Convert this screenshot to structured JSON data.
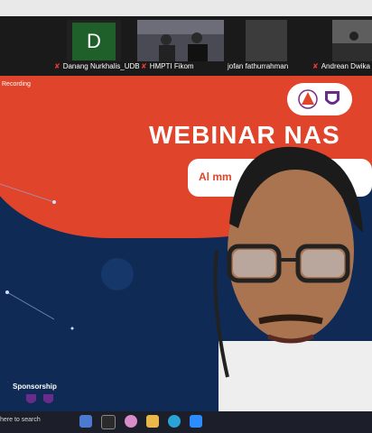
{
  "participants": [
    {
      "name": "Danang Nurkhalis_UDB",
      "avatar_letter": "D",
      "muted": true
    },
    {
      "name": "HMPTI Fikom",
      "muted": true
    },
    {
      "name": "jofan fathurrahman",
      "muted": false
    },
    {
      "name": "Andrean Dwika P",
      "muted": true
    }
  ],
  "recording_label": "Recording",
  "slide": {
    "title": "WEBINAR NAS",
    "subtitle_partial": "Al                 mm",
    "sponsorship_label": "Sponsorship"
  },
  "taskbar": {
    "search_placeholder": "here to search"
  }
}
